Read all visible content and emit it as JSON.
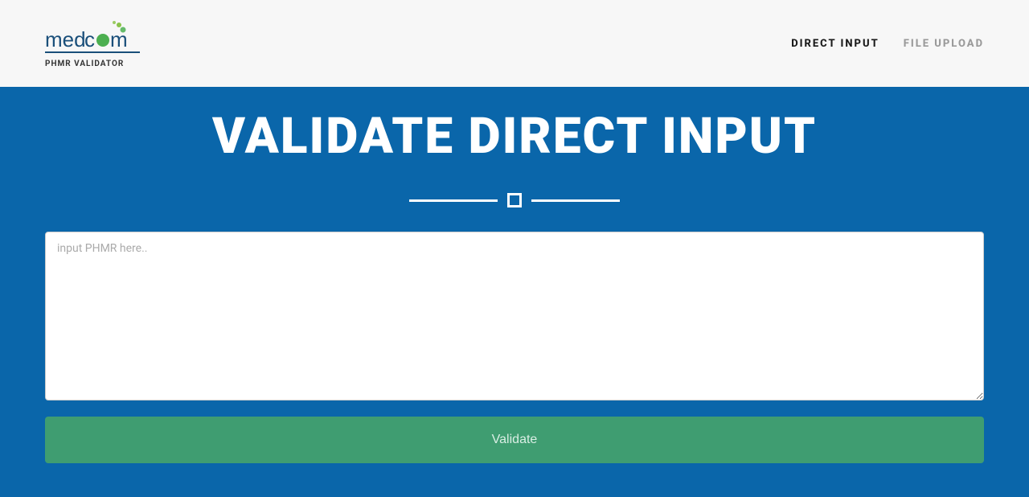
{
  "header": {
    "logo_word": "medcom",
    "logo_subtitle": "PHMR VALIDATOR",
    "nav": {
      "direct_input": "Direct Input",
      "file_upload": "File Upload"
    }
  },
  "main": {
    "title": "Validate Direct Input",
    "textarea_placeholder": "input PHMR here..",
    "textarea_value": "",
    "validate_button": "Validate"
  },
  "colors": {
    "header_bg": "#f7f7f7",
    "main_bg": "#0a66aa",
    "button_bg": "#3f9d71",
    "accent_green": "#4caf50",
    "logo_text": "#1a4f7a"
  }
}
